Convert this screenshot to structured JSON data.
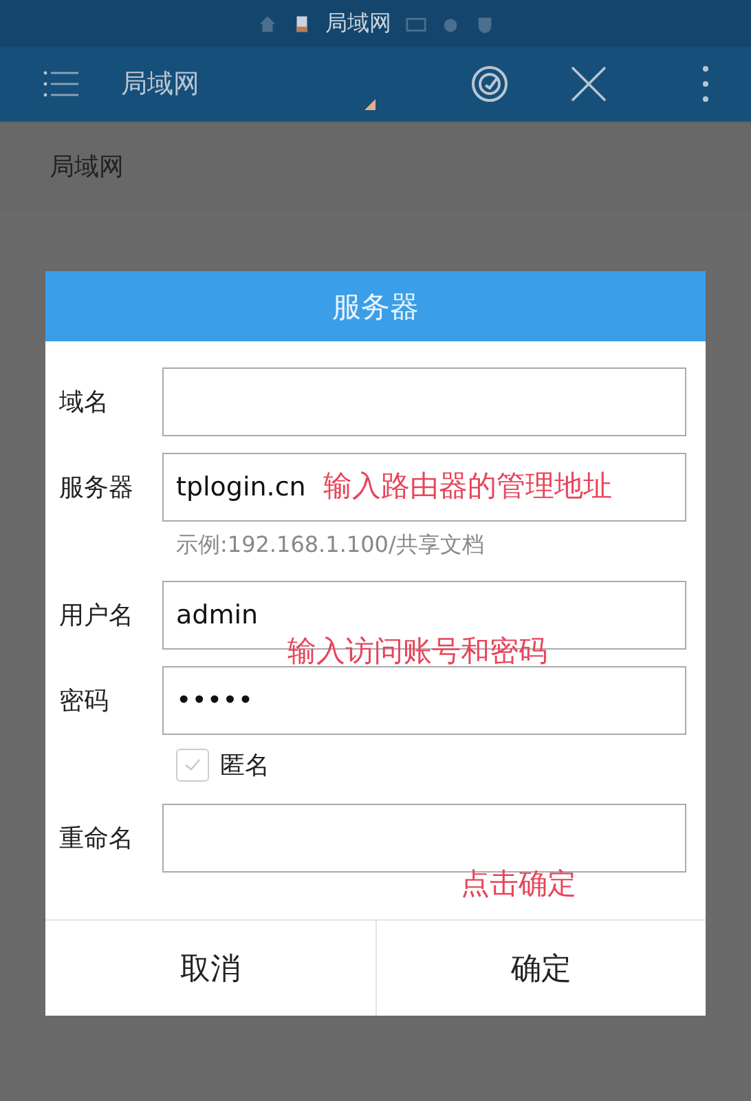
{
  "status_bar": {
    "title": "局域网"
  },
  "toolbar": {
    "title": "局域网"
  },
  "path_bar": {
    "label": "局域网"
  },
  "dialog": {
    "title": "服务器",
    "fields": [
      {
        "kind": "field",
        "label": "域名"
      },
      {
        "kind": "field",
        "label": "服务器",
        "value": "tplogin.cn",
        "annotation": "输入路由器的管理地址"
      },
      {
        "kind": "hint",
        "text": "示例:192.168.1.100/共享文档"
      },
      {
        "kind": "field",
        "label": "用户名",
        "value": "admin"
      },
      {
        "kind": "field",
        "label": "密码",
        "value": "•••••",
        "annotation": "输入访问账号和密码"
      },
      {
        "kind": "checkbox",
        "label": "匿名",
        "checked": false
      },
      {
        "kind": "field",
        "label": "重命名",
        "annotation": "点击确定"
      }
    ],
    "buttons": [
      "取消",
      "确定"
    ]
  }
}
